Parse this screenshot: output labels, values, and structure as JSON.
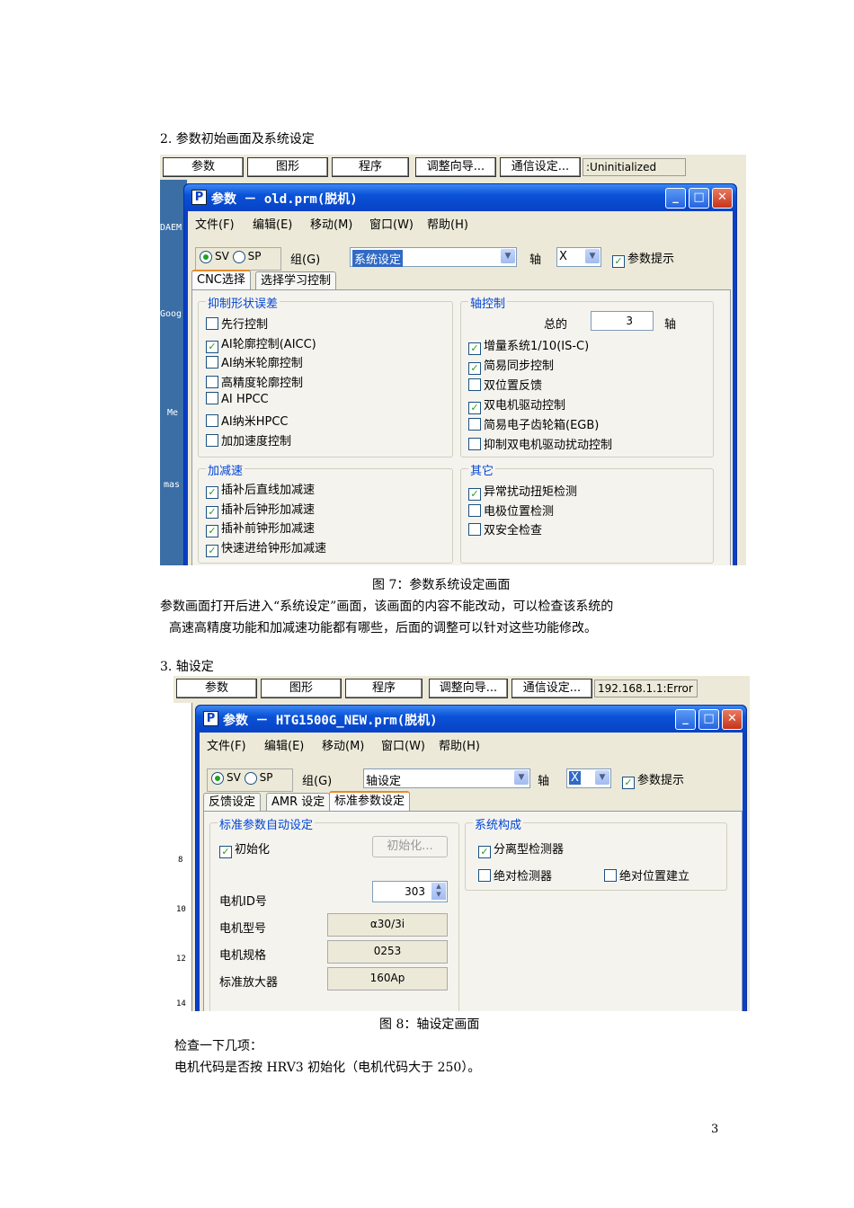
{
  "doc": {
    "heading2": "2.  参数初始画面及系统设定",
    "caption7": "图 7：参数系统设定画面",
    "para1_l1": "参数画面打开后进入“系统设定”画面，该画面的内容不能改动，可以检查该系统的",
    "para1_l2": "高速高精度功能和加减速功能都有哪些，后面的调整可以针对这些功能修改。",
    "heading3": "3.  轴设定",
    "caption8": "图 8：轴设定画面",
    "para2_l1": "检查一下几项：",
    "para2_l2": "电机代码是否按 HRV3 初始化（电机代码大于 250）。",
    "page_num": "3"
  },
  "toolbar": {
    "param": "参数",
    "graph": "图形",
    "program": "程序",
    "wizard": "调整向导...",
    "comm": "通信设定...",
    "status1": ":Uninitialized",
    "status2": "192.168.1.1:Error"
  },
  "win1": {
    "title": "参数 － old.prm(脱机)",
    "icon_letter": "P",
    "menu": [
      "文件(F)",
      "编辑(E)",
      "移动(M)",
      "窗口(W)",
      "帮助(H)"
    ],
    "sv": "SV",
    "sp": "SP",
    "group_label": "组(G)",
    "group_value": "系统设定",
    "axis_label": "轴",
    "axis_value": "X",
    "hint_label": "参数提示",
    "tabs": [
      "CNC选择",
      "选择学习控制"
    ],
    "sections": {
      "suppress": {
        "title": "抑制形状误差",
        "items": [
          {
            "label": "先行控制",
            "checked": false
          },
          {
            "label": "AI轮廓控制(AICC)",
            "checked": true
          },
          {
            "label": "AI纳米轮廓控制",
            "checked": false
          },
          {
            "label": "高精度轮廓控制",
            "checked": false
          },
          {
            "label": "AI HPCC",
            "checked": false
          },
          {
            "label": "AI纳米HPCC",
            "checked": false
          },
          {
            "label": "加加速度控制",
            "checked": false
          }
        ]
      },
      "axis": {
        "title": "轴控制",
        "total_label": "总的",
        "total_value": "3",
        "total_unit": "轴",
        "items": [
          {
            "label": "增量系统1/10(IS-C)",
            "checked": true
          },
          {
            "label": "简易同步控制",
            "checked": true
          },
          {
            "label": "双位置反馈",
            "checked": false
          },
          {
            "label": "双电机驱动控制",
            "checked": true
          },
          {
            "label": "简易电子齿轮箱(EGB)",
            "checked": false
          },
          {
            "label": "抑制双电机驱动扰动控制",
            "checked": false
          }
        ]
      },
      "accel": {
        "title": "加减速",
        "items": [
          {
            "label": "插补后直线加减速",
            "checked": true
          },
          {
            "label": "插补后钟形加减速",
            "checked": true
          },
          {
            "label": "插补前钟形加减速",
            "checked": true
          },
          {
            "label": "快速进给钟形加减速",
            "checked": true
          }
        ]
      },
      "other": {
        "title": "其它",
        "items": [
          {
            "label": "异常扰动扭矩检测",
            "checked": true
          },
          {
            "label": "电极位置检测",
            "checked": false
          },
          {
            "label": "双安全检查",
            "checked": false
          }
        ]
      }
    },
    "desktop_labels": [
      "DAEM",
      "Goog",
      "Me",
      "mas"
    ]
  },
  "win2": {
    "title": "参数 － HTG1500G_NEW.prm(脱机)",
    "icon_letter": "P",
    "menu": [
      "文件(F)",
      "编辑(E)",
      "移动(M)",
      "窗口(W)",
      "帮助(H)"
    ],
    "sv": "SV",
    "sp": "SP",
    "group_label": "组(G)",
    "group_value": "轴设定",
    "axis_label": "轴",
    "axis_value": "X",
    "hint_label": "参数提示",
    "tabs": [
      "反馈设定",
      "AMR 设定",
      "标准参数设定"
    ],
    "std": {
      "title": "标准参数自动设定",
      "init_check": "初始化",
      "init_button": "初始化...",
      "motor_id_label": "电机ID号",
      "motor_id_value": "303",
      "motor_type_label": "电机型号",
      "motor_type_value": "α30/3i",
      "motor_spec_label": "电机规格",
      "motor_spec_value": "0253",
      "amp_label": "标准放大器",
      "amp_value": "160Ap"
    },
    "sys": {
      "title": "系统构成",
      "sep_detector": "分离型检测器",
      "abs_detector": "绝对检测器",
      "abs_pos": "绝对位置建立"
    },
    "ruler_marks": [
      "8",
      "10",
      "12",
      "14"
    ]
  }
}
